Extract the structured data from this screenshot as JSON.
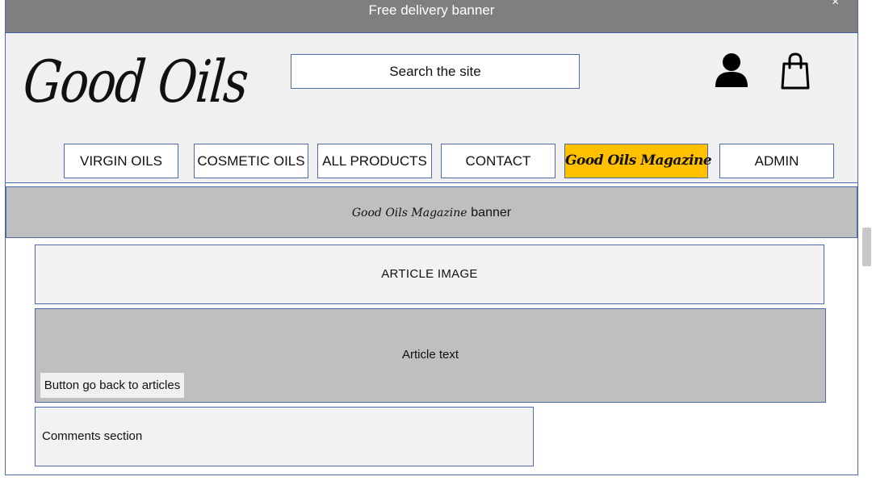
{
  "banner": {
    "text": "Free delivery banner",
    "close": "×"
  },
  "header": {
    "logo": "Good Oils",
    "search_placeholder": "Search the site"
  },
  "nav": {
    "items": [
      {
        "label": "VIRGIN OILS"
      },
      {
        "label": "COSMETIC OILS"
      },
      {
        "label": "ALL PRODUCTS"
      },
      {
        "label": "CONTACT"
      },
      {
        "label": "Good Oils Magazine"
      },
      {
        "label": "ADMIN"
      }
    ]
  },
  "magazine_banner": {
    "script_text": "Good Oils Magazine",
    "plain_text": "banner"
  },
  "article": {
    "image_label": "ARTICLE IMAGE",
    "text_label": "Article text",
    "back_button": "Button go back to articles"
  },
  "comments": {
    "label": "Comments section"
  },
  "colors": {
    "magazine_accent": "#ffc000",
    "banner_gray": "#7f7f7f",
    "border_blue": "#4a6aa8"
  },
  "icons": {
    "account": "user-icon",
    "cart": "shopping-bag-icon"
  }
}
